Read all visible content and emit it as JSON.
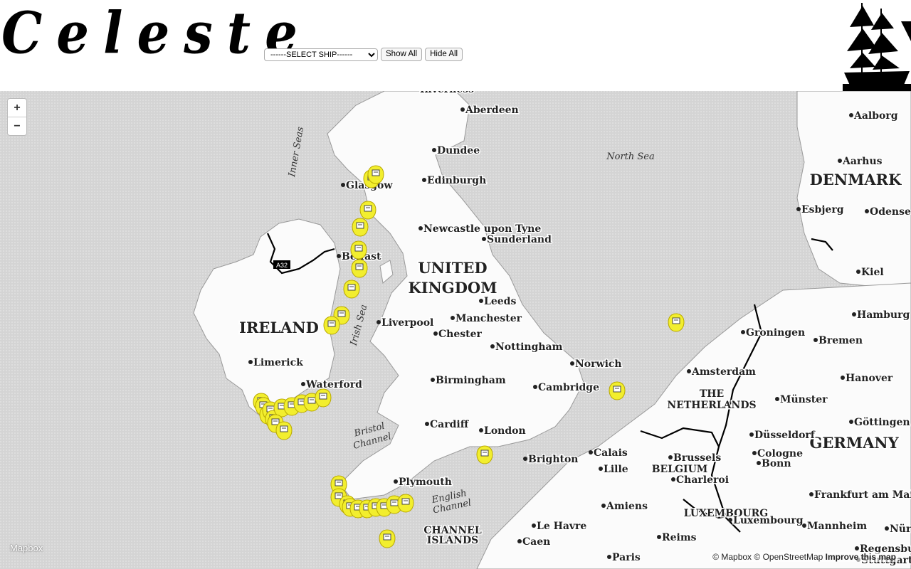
{
  "header": {
    "logo_text": "Celeste",
    "select_placeholder": "------SELECT SHIP------",
    "show_all_label": "Show All",
    "hide_all_label": "Hide All"
  },
  "map": {
    "zoom_in": "+",
    "zoom_out": "−",
    "mapbox_logo": "Mapbox",
    "attribution": {
      "mapbox": "© Mapbox",
      "osm": "© OpenStreetMap",
      "improve": "Improve this map"
    },
    "road_label": "A32",
    "colors": {
      "marker": "#f2ee2e",
      "land": "#ffffff",
      "sea": "#d6d6d6",
      "border": "#000000"
    },
    "countries": [
      {
        "name": "UNITED",
        "cls": "country"
      },
      {
        "name": "KINGDOM",
        "cls": "country"
      },
      {
        "name": "IRELAND",
        "cls": "country"
      },
      {
        "name": "DENMARK",
        "cls": "country"
      },
      {
        "name": "GERMANY",
        "cls": "country"
      },
      {
        "name": "THE",
        "cls": "country-s"
      },
      {
        "name": "NETHERLANDS",
        "cls": "country-s"
      },
      {
        "name": "BELGIUM",
        "cls": "country-s"
      },
      {
        "name": "LUXEMBOURG",
        "cls": "country-s"
      },
      {
        "name": "CHANNEL",
        "cls": "country-s"
      },
      {
        "name": "ISLANDS",
        "cls": "country-s"
      }
    ],
    "seas": [
      "North Sea",
      "Inner Seas",
      "Irish Sea",
      "Bristol",
      "Channel",
      "English",
      "Channel"
    ],
    "cities": [
      "Inverness",
      "Aberdeen",
      "Dundee",
      "Edinburgh",
      "Glasgow",
      "Newcastle upon Tyne",
      "Sunderland",
      "Belfast",
      "Leeds",
      "Liverpool",
      "Manchester",
      "Chester",
      "Nottingham",
      "Birmingham",
      "Norwich",
      "Cambridge",
      "Cardiff",
      "London",
      "Brighton",
      "Plymouth",
      "Limerick",
      "Waterford",
      "Aalborg",
      "Aarhus",
      "Esbjerg",
      "Odense",
      "Kiel",
      "Hamburg",
      "Groningen",
      "Bremen",
      "Amsterdam",
      "Hanover",
      "Münster",
      "Göttingen",
      "Düsseldorf",
      "Cologne",
      "Bonn",
      "Calais",
      "Brussels",
      "Lille",
      "Charleroi",
      "Amiens",
      "Le Havre",
      "Caen",
      "Reims",
      "Paris",
      "Luxembourg",
      "Frankfurt am Main",
      "Mannheim",
      "Regensburg",
      "Stuttgart",
      "Nür"
    ],
    "markers_count": 35
  }
}
